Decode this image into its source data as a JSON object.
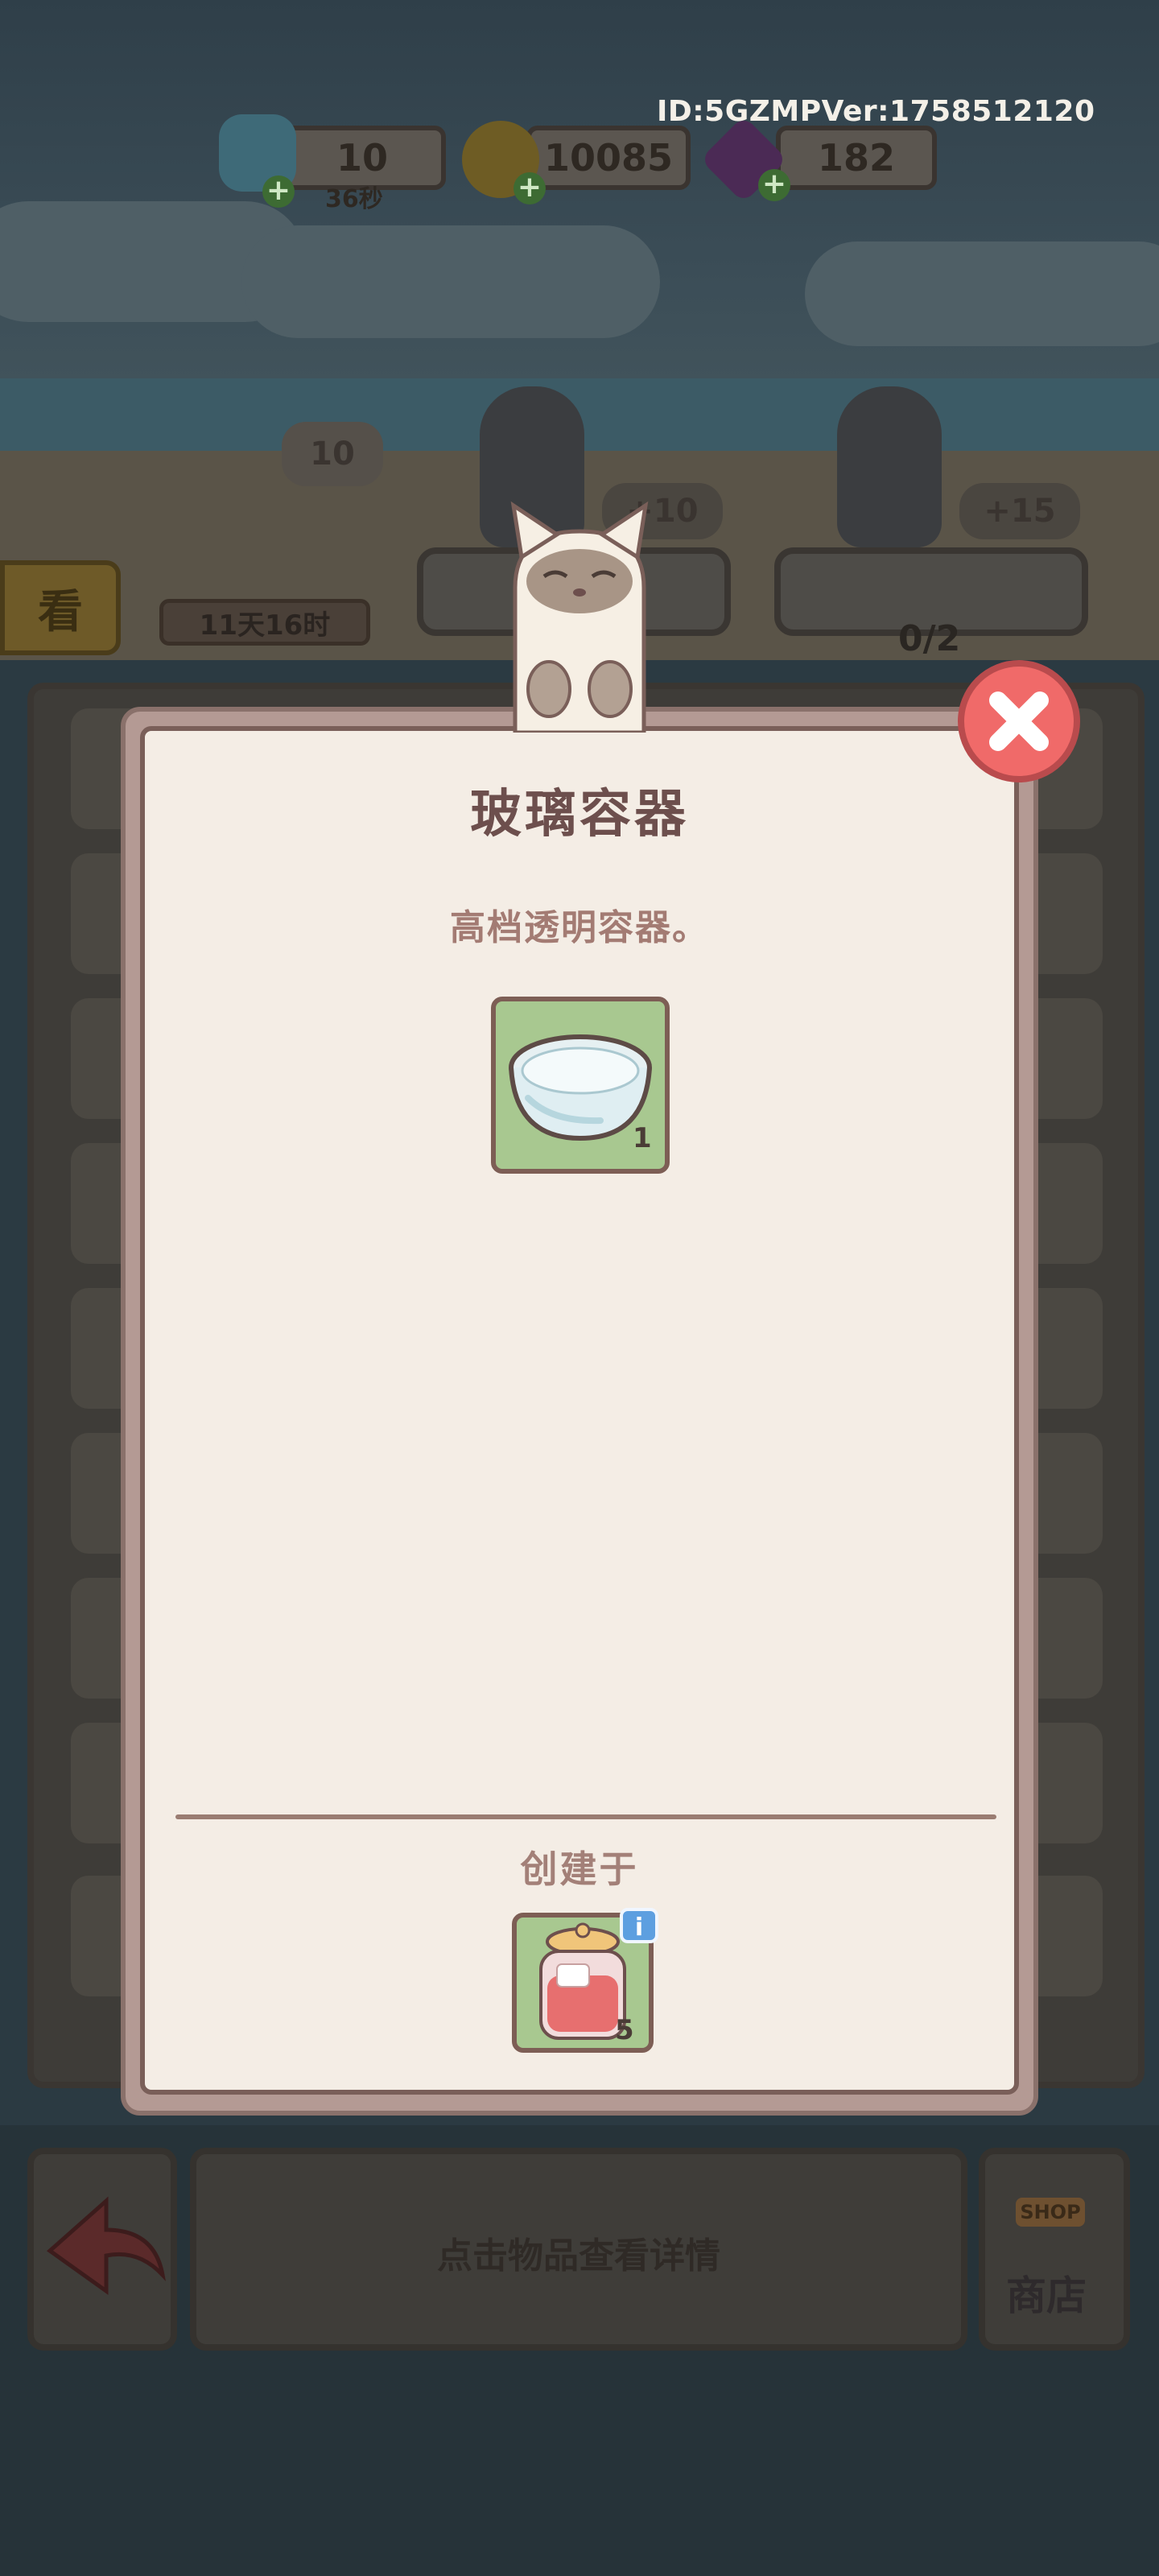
{
  "header": {
    "user_id": "ID:5GZMPVer:1758512120",
    "energy": {
      "value": "10",
      "timer": "36秒",
      "icon": "lightning-icon"
    },
    "coins": {
      "value": "10085",
      "icon": "coin-icon"
    },
    "gems": {
      "value": "182",
      "icon": "gem-icon"
    },
    "plus_symbol": "+"
  },
  "scene": {
    "look_button": "看",
    "event_timer": "11天16时",
    "energy_bubble": "10",
    "reward_left": "+10",
    "reward_right": "+15",
    "order_progress": "0/2"
  },
  "modal": {
    "title": "玻璃容器",
    "description": "高档透明容器。",
    "item": {
      "name": "glass-bowl",
      "quantity": "1",
      "icon": "glass-bowl-icon"
    },
    "created_label": "创建于",
    "source_item": {
      "name": "glass-jar",
      "quantity": "5",
      "icon": "glass-jar-icon",
      "info_badge": "i"
    },
    "close_icon": "close-icon"
  },
  "bottom": {
    "back_icon": "back-arrow-icon",
    "hint": "点击物品查看详情",
    "shop_sign": "SHOP",
    "shop_label": "商店"
  },
  "colors": {
    "modal_bg": "#f4ede5",
    "title": "#6d4f4d",
    "description": "#a37b73",
    "card_bg": "#a8c890",
    "close": "#f06a69",
    "info_badge": "#5d9fe0"
  }
}
